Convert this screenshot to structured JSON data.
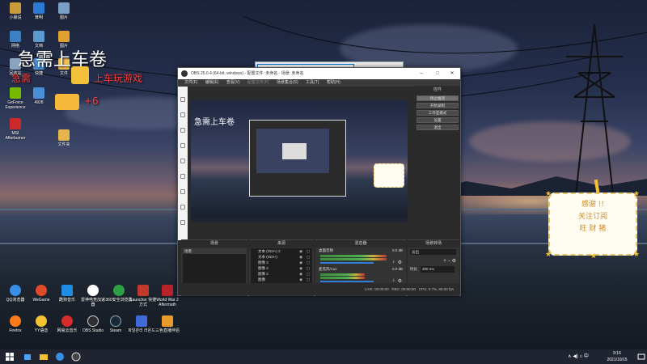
{
  "desktop": {
    "icons_left_top": [
      {
        "label": "小晨说",
        "color": "#c99b3a"
      },
      {
        "label": "茸明",
        "color": "#2d7ad6"
      },
      {
        "label": "图片",
        "color": "#7aa0c8"
      }
    ],
    "icons_grid": [
      {
        "label": "网络",
        "color": "#3b7fc4"
      },
      {
        "label": "文档",
        "color": "#5a9ad0"
      },
      {
        "label": "图片",
        "color": "#e0a030"
      },
      {
        "label": "回收站",
        "color": "#8aa4c0"
      },
      {
        "label": "快捷",
        "color": "#4e8fd4"
      },
      {
        "label": "文件",
        "color": "#f0c050"
      },
      {
        "label": "GeForce Experience",
        "color": "#76b900"
      },
      {
        "label": "4928",
        "color": "#4a90d9"
      },
      {
        "label": "MSI Afterburner",
        "color": "#cc2a2a"
      },
      {
        "label": "文件夹",
        "color": "#e6b44c"
      }
    ],
    "dock_icons": [
      {
        "label": "QQ浏览器",
        "color": "#3a8ee6"
      },
      {
        "label": "WeGame",
        "color": "#e04a2a"
      },
      {
        "label": "酷狗音乐",
        "color": "#1f8ce6"
      },
      {
        "label": "雷神电竞加速器",
        "color": "#ffffff"
      },
      {
        "label": "360安全浏览器",
        "color": "#2ea043"
      },
      {
        "label": "Launcher 快捷方式",
        "color": "#c0392b"
      },
      {
        "label": "World War 2 Aftermath",
        "color": "#b8222a"
      },
      {
        "label": "Firefox",
        "color": "#ff7a1a"
      },
      {
        "label": "YY语音",
        "color": "#f2c230"
      },
      {
        "label": "网易云音乐",
        "color": "#d62c2c"
      },
      {
        "label": "OBS Studio",
        "color": "#302e31"
      },
      {
        "label": "Steam",
        "color": "#1b2838"
      },
      {
        "label": "파일관리 라온드",
        "color": "#3f6ad8"
      },
      {
        "label": "三色直播伴侣",
        "color": "#e89a2a"
      }
    ],
    "banner": {
      "line1": "急需上车卷",
      "line2": "急需",
      "line3": "上车玩游戏",
      "line4": "+6"
    }
  },
  "explorer": {
    "address": ""
  },
  "obs": {
    "title": "OBS 25.0.4 (64-bit, windows) - 配置文件: 未命名 - 场景: 未命名",
    "menu": [
      "文件(F)",
      "编辑(E)",
      "查看(V)",
      "配置文件(P)",
      "场景集合(S)",
      "工具(T)",
      "帮助(H)"
    ],
    "controls_title": "控件",
    "controls": [
      "停止推流",
      "开始录制",
      "工作室模式",
      "设置",
      "退出"
    ],
    "scenes_title": "场景",
    "scenes": [
      "场景"
    ],
    "sources_title": "来源",
    "sources": [
      "文本 (GDI+) 2",
      "文本 (GDI+)",
      "图像 3",
      "图像 4",
      "图像 2",
      "图像"
    ],
    "mixer_title": "混音器",
    "mixer": [
      {
        "name": "桌面音频",
        "db": "0.0 dB",
        "level": 0.82,
        "volume": 0.85
      },
      {
        "name": "麦克风/Aux",
        "db": "0.0 dB",
        "level": 0.55,
        "volume": 0.85
      }
    ],
    "transitions_title": "场景转场",
    "transition": "淡出",
    "duration_label": "时长",
    "duration_value": "300 ms",
    "status": {
      "live": "LIVE: 00:00:00",
      "rec": "REC: 00:00:00",
      "cpu": "CPU: 0.7%, 60.00 fps"
    }
  },
  "card": {
    "line1": "感谢 !!",
    "line2": "关注订阅",
    "line3": "旺 财 猪"
  },
  "taskbar": {
    "time": "9:16",
    "date": "2021/10/15",
    "ime": "中"
  }
}
